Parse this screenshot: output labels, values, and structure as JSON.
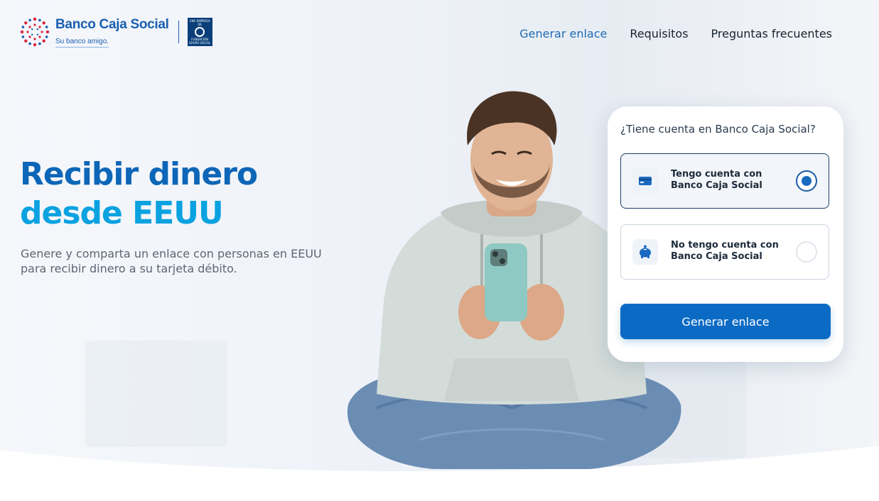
{
  "header": {
    "logo": {
      "name": "Banco Caja Social",
      "tagline": "Su banco amigo.",
      "partner_small": "UNA EMPRESA DE",
      "partner_name": "FUNDACIÓN GRUPO SOCIAL"
    },
    "nav": [
      {
        "label": "Generar enlace",
        "active": true
      },
      {
        "label": "Requisitos",
        "active": false
      },
      {
        "label": "Preguntas frecuentes",
        "active": false
      }
    ]
  },
  "hero": {
    "title_line1": "Recibir dinero",
    "title_line2": "desde EEUU",
    "subtitle": "Genere y comparta un enlace con personas en EEUU para recibir dinero a su tarjeta débito."
  },
  "card": {
    "question": "¿Tiene cuenta en Banco Caja Social?",
    "options": [
      {
        "label": "Tengo cuenta con Banco Caja Social",
        "icon": "card-icon",
        "selected": true
      },
      {
        "label": "No tengo cuenta con Banco Caja Social",
        "icon": "piggy-bank-icon",
        "selected": false
      }
    ],
    "button": "Generar enlace"
  },
  "colors": {
    "brand_blue": "#0b6bc4",
    "title_dark_blue": "#0d66b7",
    "title_light_blue": "#0aa2e0"
  }
}
